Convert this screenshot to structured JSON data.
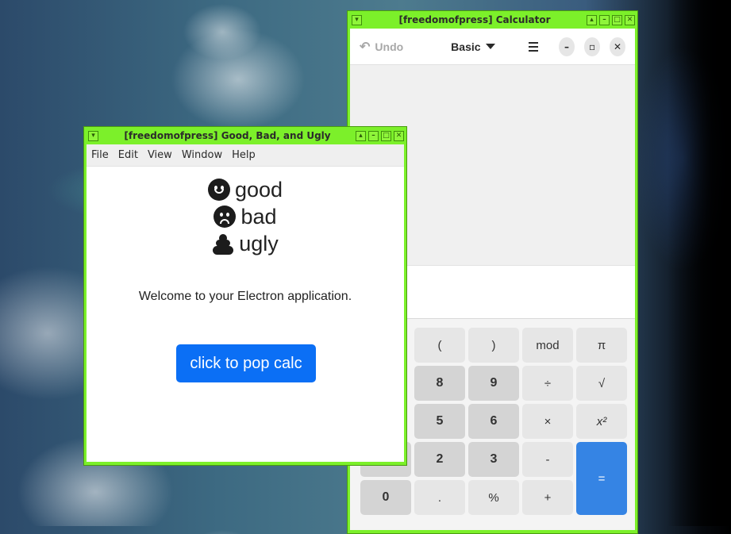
{
  "desktop": {
    "wallpaper": "satellite-earth"
  },
  "calculator_window": {
    "title": "[freedomofpress] Calculator",
    "header": {
      "undo_label": "Undo",
      "mode_label": "Basic"
    },
    "keys": [
      "(",
      ")",
      "mod",
      "π",
      "8",
      "9",
      "÷",
      "√",
      "5",
      "6",
      "×",
      "x²",
      "2",
      "3",
      "-",
      "=",
      "0",
      ".",
      "%",
      "+"
    ]
  },
  "gbu_window": {
    "title": "[freedomofpress] Good, Bad, and Ugly",
    "menu": [
      "File",
      "Edit",
      "View",
      "Window",
      "Help"
    ],
    "items": [
      {
        "icon": "smiling-face-icon",
        "label": "good"
      },
      {
        "icon": "frowning-face-icon",
        "label": "bad"
      },
      {
        "icon": "poop-icon",
        "label": "ugly"
      }
    ],
    "welcome": "Welcome to your Electron application.",
    "button_label": "click to pop calc"
  },
  "colors": {
    "window_border": "#7cf02a",
    "accent_blue": "#0b6ff5",
    "equals_blue": "#3584e4"
  }
}
